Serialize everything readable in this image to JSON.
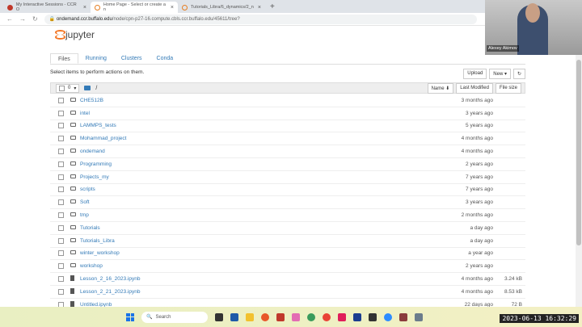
{
  "browser": {
    "tabs": [
      {
        "title": "My Interactive Sessions - CCR O"
      },
      {
        "title": "Home Page - Select or create a n"
      },
      {
        "title": "Tutorials_Libra/6_dynamics/2_n"
      }
    ],
    "url_host": "ondemand.ccr.buffalo.edu",
    "url_path": "/node/cpn-p27-16.compute.cbls.ccr.buffalo.edu/45611/tree?"
  },
  "jupyter": {
    "logo": "jupyter",
    "tabs": [
      "Files",
      "Running",
      "Clusters",
      "Conda"
    ],
    "hint": "Select items to perform actions on them.",
    "upload": "Upload",
    "new": "New ▾",
    "selected_count": "0",
    "path": "/",
    "sort_name": "Name ⬇",
    "sort_modified": "Last Modified",
    "sort_size": "File size",
    "files": [
      {
        "name": "CHE512B",
        "type": "folder",
        "modified": "3 months ago",
        "size": ""
      },
      {
        "name": "intel",
        "type": "folder",
        "modified": "3 years ago",
        "size": ""
      },
      {
        "name": "LAMMPS_tests",
        "type": "folder",
        "modified": "5 years ago",
        "size": ""
      },
      {
        "name": "Mohammad_project",
        "type": "folder",
        "modified": "4 months ago",
        "size": ""
      },
      {
        "name": "ondemand",
        "type": "folder",
        "modified": "4 months ago",
        "size": ""
      },
      {
        "name": "Programming",
        "type": "folder",
        "modified": "2 years ago",
        "size": ""
      },
      {
        "name": "Projects_my",
        "type": "folder",
        "modified": "7 years ago",
        "size": ""
      },
      {
        "name": "scripts",
        "type": "folder",
        "modified": "7 years ago",
        "size": ""
      },
      {
        "name": "Soft",
        "type": "folder",
        "modified": "3 years ago",
        "size": ""
      },
      {
        "name": "tmp",
        "type": "folder",
        "modified": "2 months ago",
        "size": ""
      },
      {
        "name": "Tutorials",
        "type": "folder",
        "modified": "a day ago",
        "size": ""
      },
      {
        "name": "Tutorials_Libra",
        "type": "folder",
        "modified": "a day ago",
        "size": ""
      },
      {
        "name": "winter_workshop",
        "type": "folder",
        "modified": "a year ago",
        "size": ""
      },
      {
        "name": "workshop",
        "type": "folder",
        "modified": "2 years ago",
        "size": ""
      },
      {
        "name": "Lesson_2_16_2023.ipynb",
        "type": "notebook",
        "modified": "4 months ago",
        "size": "3.24 kB"
      },
      {
        "name": "Lesson_2_21_2023.ipynb",
        "type": "notebook",
        "modified": "4 months ago",
        "size": "8.53 kB"
      },
      {
        "name": "Untitled.ipynb",
        "type": "notebook",
        "modified": "22 days ago",
        "size": "72 B"
      }
    ]
  },
  "webcam": {
    "name": "Alexey Akimov"
  },
  "taskbar": {
    "search": "Search",
    "clock": "2023-06-13 16:32:29"
  }
}
